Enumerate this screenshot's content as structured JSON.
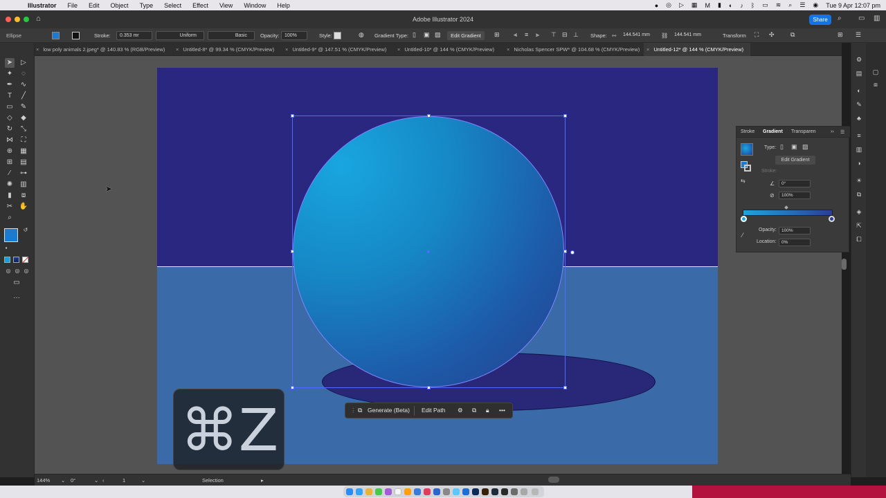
{
  "menubar": {
    "app_name": "Illustrator",
    "items": [
      "File",
      "Edit",
      "Object",
      "Type",
      "Select",
      "Effect",
      "View",
      "Window",
      "Help"
    ],
    "datetime": "Tue 9 Apr  12:07 pm"
  },
  "titlebar": {
    "title": "Adobe Illustrator 2024",
    "share_label": "Share"
  },
  "controlbar": {
    "object_type": "Ellipse",
    "stroke_label": "Stroke:",
    "stroke_value": "0.353 mr",
    "stroke_profile": "Uniform",
    "brush": "Basic",
    "opacity_label": "Opacity:",
    "opacity_value": "100%",
    "style_label": "Style:",
    "gradient_type_label": "Gradient Type:",
    "edit_gradient_label": "Edit Gradient",
    "shape_label": "Shape:",
    "width_value": "144.541 mm",
    "height_value": "144.541 mm",
    "transform_label": "Transform",
    "colors": {
      "fill": "#1b7bd0",
      "stroke": "#111111"
    }
  },
  "tabs": [
    {
      "label": "low poly animals 2.jpeg* @ 140.83 % (RGB/Preview)",
      "active": false
    },
    {
      "label": "Untitled-8* @ 99.34 % (CMYK/Preview)",
      "active": false
    },
    {
      "label": "Untitled-9* @ 147.51 % (CMYK/Preview)",
      "active": false
    },
    {
      "label": "Untitled-10* @ 144 % (CMYK/Preview)",
      "active": false
    },
    {
      "label": "Nicholas Spencer SPW* @ 104.68 % (CMYK/Preview)",
      "active": false
    },
    {
      "label": "Untitled-12* @ 144 % (CMYK/Preview)",
      "active": true
    }
  ],
  "context_bar": {
    "generate_label": "Generate (Beta)",
    "edit_path_label": "Edit Path"
  },
  "shortcut_overlay": {
    "keys": "⌘Z"
  },
  "gradient_panel": {
    "tab_stroke": "Stroke",
    "tab_gradient": "Gradient",
    "tab_transparency": "Transparen",
    "type_label": "Type:",
    "edit_gradient_label": "Edit Gradient",
    "stroke_label": "Stroke:",
    "angle_value": "0°",
    "aspect_value": "100%",
    "opacity_label": "Opacity:",
    "opacity_value": "100%",
    "location_label": "Location:",
    "location_value": "0%",
    "start_color": "#1aa7e0",
    "end_color": "#2b3d99"
  },
  "statusbar": {
    "zoom": "144%",
    "rotation": "0°",
    "artboard_number": "1",
    "tool": "Selection"
  },
  "artwork": {
    "sky_color": "#2a2780",
    "ground_color": "#3a6ba8",
    "shadow_color": "#282778"
  }
}
